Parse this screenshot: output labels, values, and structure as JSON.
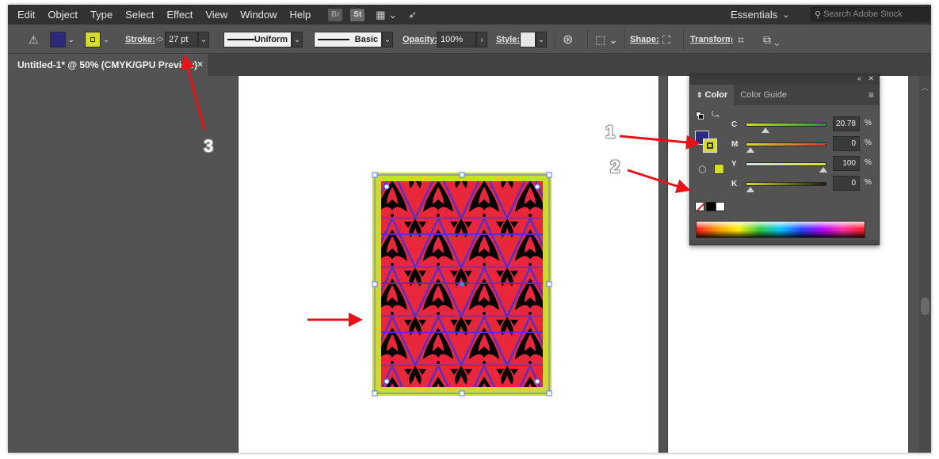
{
  "menu": [
    "Edit",
    "Object",
    "Type",
    "Select",
    "Effect",
    "View",
    "Window",
    "Help"
  ],
  "badges": {
    "bridge": "Br",
    "stock": "St"
  },
  "workspace": {
    "label": "Essentials",
    "chevron": "⌄"
  },
  "search": {
    "placeholder": "Search Adobe Stock"
  },
  "controlbar": {
    "stroke_label": "Stroke:",
    "stroke_value": "27 pt",
    "profile_uniform": "Uniform",
    "brush_basic": "Basic",
    "opacity_label": "Opacity:",
    "opacity_value": "100%",
    "style_label": "Style:",
    "shape_label": "Shape:",
    "transform_label": "Transform",
    "fill_color": "#2b2a7a",
    "stroke_color": "#d4dc2a"
  },
  "document_tab": {
    "title": "Untitled-1* @ 50% (CMYK/GPU Preview)",
    "close": "×"
  },
  "color_panel": {
    "tabs": [
      "Color",
      "Color Guide"
    ],
    "active_tab": "Color",
    "sliders": [
      {
        "letter": "C",
        "value": "20.78",
        "unit": "%",
        "level": 0.2078
      },
      {
        "letter": "M",
        "value": "0",
        "unit": "%",
        "level": 0
      },
      {
        "letter": "Y",
        "value": "100",
        "unit": "%",
        "level": 1.0
      },
      {
        "letter": "K",
        "value": "0",
        "unit": "%",
        "level": 0
      }
    ],
    "fill_swatch": "#2b2a7a",
    "stroke_swatch": "#d4dc2a"
  },
  "annotations": {
    "one": "1",
    "two": "2",
    "three": "3"
  },
  "artwork": {
    "stroke_color": "#cfd92e",
    "base_color": "#e8283a",
    "ornament_color": "#000000",
    "line_color": "#5a2ec8"
  }
}
